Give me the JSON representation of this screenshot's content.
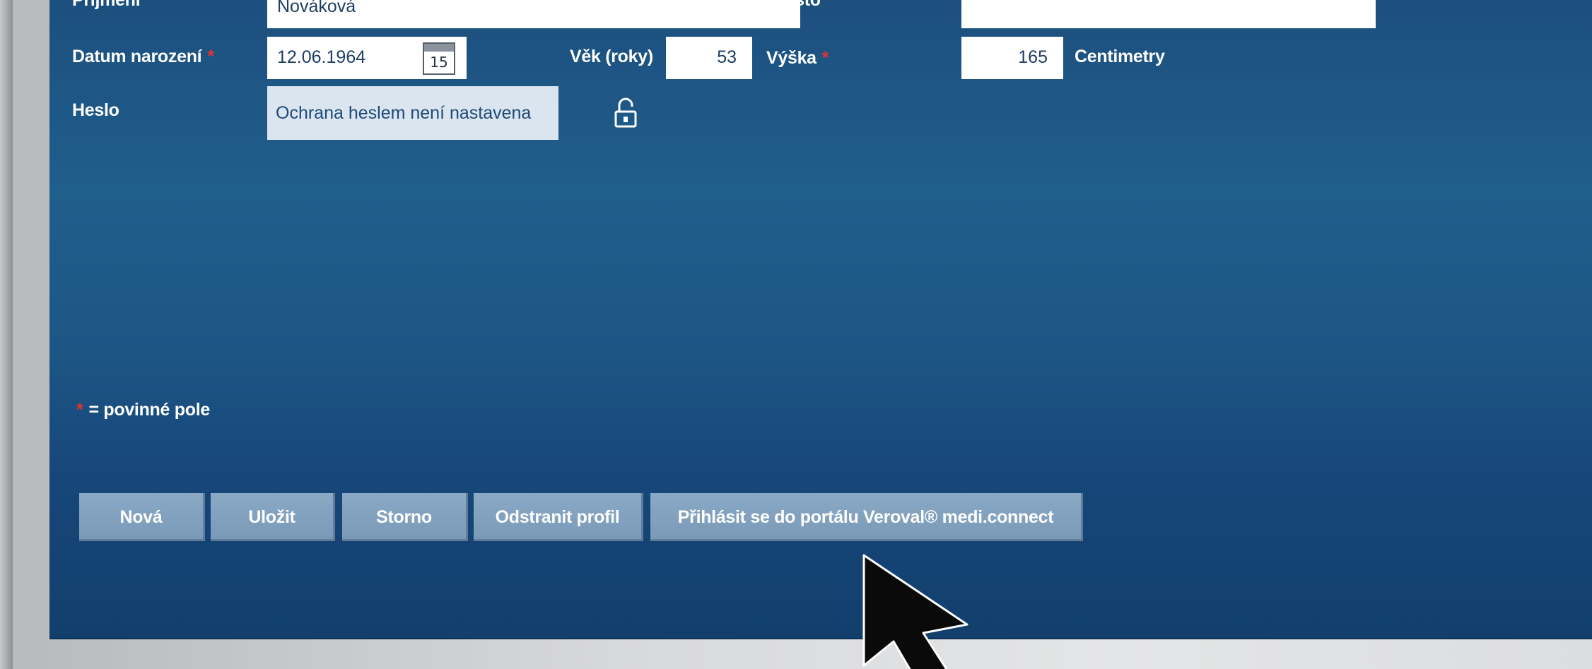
{
  "form": {
    "row0": {
      "surname_label": "Příjmení",
      "surname_value": "Nováková",
      "city_label": "Město",
      "city_value": ""
    },
    "birth_label": "Datum narození",
    "birth_value": "12.06.1964",
    "calendar_day": "15",
    "age_label": "Věk (roky)",
    "age_value": "53",
    "height_label": "Výška",
    "height_value": "165",
    "height_unit": "Centimetry",
    "password_label": "Heslo",
    "password_value": "Ochrana heslem není nastavena",
    "required_asterisk": "*",
    "required_note": "= povinné pole"
  },
  "buttons": {
    "new": "Nová",
    "save": "Uložit",
    "cancel": "Storno",
    "delete_profile": "Odstranit profil",
    "login_portal": "Přihlásit se do portálu Veroval® medi.connect"
  },
  "colors": {
    "panel_bg": "#1d5685",
    "button_bg": "#7f9fbd",
    "required": "#e8332f"
  },
  "icons": {
    "calendar": "calendar-icon",
    "lock": "unlocked-padlock-icon",
    "cursor": "mouse-pointer-icon"
  }
}
